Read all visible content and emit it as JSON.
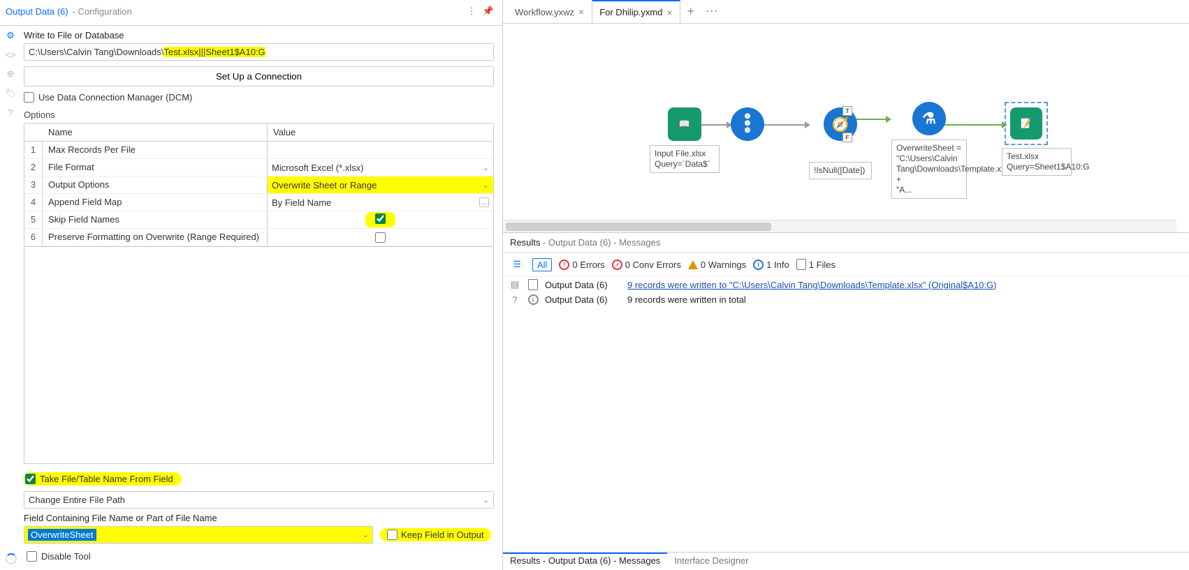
{
  "config": {
    "title": "Output Data (6)",
    "subtitle": "- Configuration",
    "write_label": "Write to File or Database",
    "path_plain": "C:\\Users\\Calvin Tang\\Downloads\\",
    "path_hl": "Test.xlsx|||Sheet1$A10:G",
    "setup_btn": "Set Up a Connection",
    "dcm_label": "Use Data Connection Manager (DCM)",
    "options_label": "Options",
    "col_name": "Name",
    "col_value": "Value",
    "rows": [
      {
        "n": "1",
        "name": "Max Records Per File",
        "val": ""
      },
      {
        "n": "2",
        "name": "File Format",
        "val": "Microsoft Excel (*.xlsx)"
      },
      {
        "n": "3",
        "name": "Output Options",
        "val": "Overwrite Sheet or Range"
      },
      {
        "n": "4",
        "name": "Append Field Map",
        "val": "By Field Name"
      },
      {
        "n": "5",
        "name": "Skip Field Names",
        "val": ""
      },
      {
        "n": "6",
        "name": "Preserve Formatting on Overwrite (Range Required)",
        "val": ""
      }
    ],
    "take_file_label": "Take File/Table Name From Field",
    "change_path_label": "Change Entire File Path",
    "field_containing_label": "Field Containing File Name or Part of File Name",
    "overwrite_field": "OverwriteSheet",
    "keep_field_label": "Keep Field in Output",
    "disable_label": "Disable Tool"
  },
  "tabs": {
    "t1": "Workflow.yxwz",
    "t2": "For Dhilip.yxmd"
  },
  "canvas": {
    "input_label": "Input File.xlsx\nQuery=`Data$`",
    "filter_label": "!IsNull([Date])",
    "formula_label": "OverwriteSheet = \"C:\\Users\\Calvin Tang\\Downloads\\Template.xlsx|||Original$\"\n+\n\"A...",
    "output_label": "Test.xlsx\nQuery=Sheet1$A10:G"
  },
  "results": {
    "header_strong": "Results",
    "header_rest": "- Output Data (6) - Messages",
    "filters": {
      "all": "All",
      "errors": "0 Errors",
      "conv": "0 Conv Errors",
      "warnings": "0 Warnings",
      "info": "1 Info",
      "files": "1 Files"
    },
    "rows": [
      {
        "source": "Output Data (6)",
        "text_link": "9 records were written to \"C:\\Users\\Calvin Tang\\Downloads\\Template.xlsx\" (Original$A10:G)"
      },
      {
        "source": "Output Data (6)",
        "text": "9 records were written in total"
      }
    ]
  },
  "bottom_tabs": {
    "results": "Results - Output Data (6) - Messages",
    "designer": "Interface Designer"
  }
}
